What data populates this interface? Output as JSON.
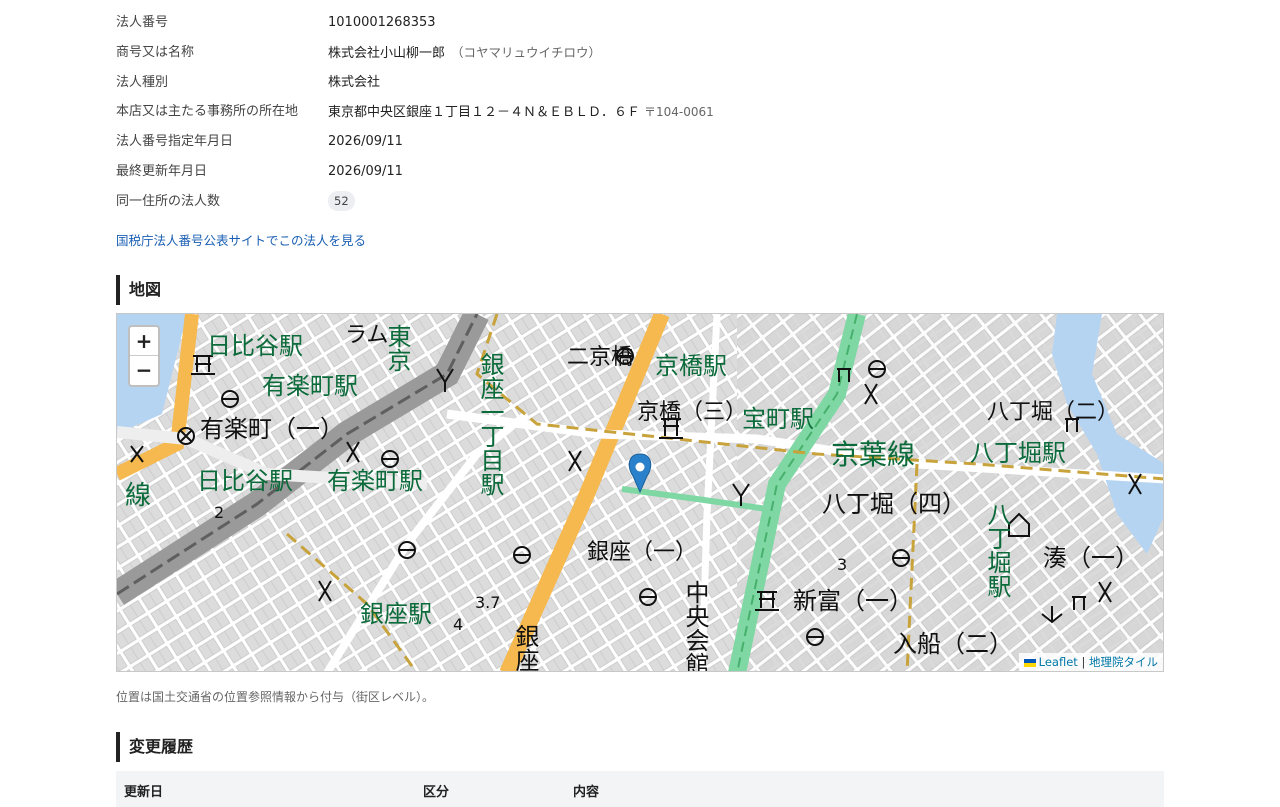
{
  "info": [
    {
      "label": "法人番号",
      "value": "1010001268353"
    },
    {
      "label": "商号又は名称",
      "value": "株式会社小山柳一郎",
      "kana": "（コヤマリュウイチロウ）"
    },
    {
      "label": "法人種別",
      "value": "株式会社"
    },
    {
      "label": "本店又は主たる事務所の所在地",
      "value": "東京都中央区銀座１丁目１２－４Ｎ＆ＥＢＬＤ．６Ｆ",
      "postal": "〒104-0061"
    },
    {
      "label": "法人番号指定年月日",
      "value": "2026/09/11"
    },
    {
      "label": "最終更新年月日",
      "value": "2026/09/11"
    },
    {
      "label": "同一住所の法人数",
      "badge": "52"
    }
  ],
  "nta_link": "国税庁法人番号公表サイトでこの法人を見る",
  "map_section": {
    "title": "地図",
    "zoom_in": "+",
    "zoom_out": "−",
    "attribution_leaflet": "Leaflet",
    "attribution_sep": "|",
    "attribution_tiles": "地理院タイル",
    "note": "位置は国土交通省の位置参照情報から付与（街区レベル）。",
    "labels": {
      "hibiya_eki": "日比谷駅",
      "yurakucho_eki_1": "有楽町駅",
      "yurakucho_1": "有楽町（一）",
      "hibiya_eki_2": "日比谷駅",
      "yurakucho_eki_2": "有楽町駅",
      "ginza_eki": "銀座駅",
      "kyobashi_eki": "京橋駅",
      "kyobashi_3": "京橋（三）",
      "takaracho_eki": "宝町駅",
      "keiyo_sen": "京葉線",
      "hatchobori_eki": "八丁堀駅",
      "hatchobori_4": "八丁堀（四）",
      "hatchobori_2": "八丁堀（二）",
      "minato_1": "湊（一）",
      "shintomi_1": "新富（一）",
      "irifune_2": "入船（二）",
      "ginza_1": "銀座（一）",
      "ginza_1_chome": "銀座一丁目駅",
      "chuo_kaikan": "中央会館",
      "ginza_v": "銀座",
      "hatchobori_v": "八丁堀駅",
      "kyobashi_v2": "二京橋",
      "tokyo_v": "東京",
      "ramu": "ラム",
      "sen": "線",
      "h_2": "2",
      "h_3": "3",
      "h_37": "3.7",
      "h_4": "4"
    }
  },
  "history_section": {
    "title": "変更履歴",
    "columns": [
      "更新日",
      "区分",
      "内容"
    ]
  },
  "colors": {
    "accent_link": "#1a5fb4",
    "station_green": "#0b6b3a",
    "marker_blue": "#2a81cb",
    "main_road": "#f5b94f",
    "rail_green": "#6fcf97"
  }
}
